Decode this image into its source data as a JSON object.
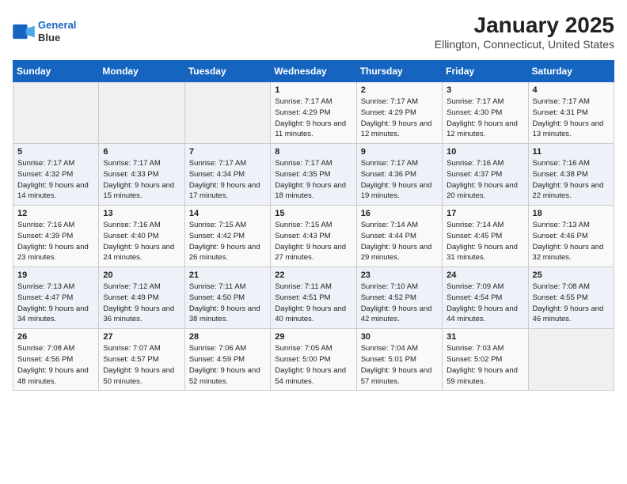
{
  "header": {
    "logo_line1": "General",
    "logo_line2": "Blue",
    "month": "January 2025",
    "location": "Ellington, Connecticut, United States"
  },
  "weekdays": [
    "Sunday",
    "Monday",
    "Tuesday",
    "Wednesday",
    "Thursday",
    "Friday",
    "Saturday"
  ],
  "weeks": [
    [
      {
        "day": "",
        "empty": true
      },
      {
        "day": "",
        "empty": true
      },
      {
        "day": "",
        "empty": true
      },
      {
        "day": "1",
        "sunrise": "7:17 AM",
        "sunset": "4:29 PM",
        "daylight": "9 hours and 11 minutes."
      },
      {
        "day": "2",
        "sunrise": "7:17 AM",
        "sunset": "4:29 PM",
        "daylight": "9 hours and 12 minutes."
      },
      {
        "day": "3",
        "sunrise": "7:17 AM",
        "sunset": "4:30 PM",
        "daylight": "9 hours and 12 minutes."
      },
      {
        "day": "4",
        "sunrise": "7:17 AM",
        "sunset": "4:31 PM",
        "daylight": "9 hours and 13 minutes."
      }
    ],
    [
      {
        "day": "5",
        "sunrise": "7:17 AM",
        "sunset": "4:32 PM",
        "daylight": "9 hours and 14 minutes."
      },
      {
        "day": "6",
        "sunrise": "7:17 AM",
        "sunset": "4:33 PM",
        "daylight": "9 hours and 15 minutes."
      },
      {
        "day": "7",
        "sunrise": "7:17 AM",
        "sunset": "4:34 PM",
        "daylight": "9 hours and 17 minutes."
      },
      {
        "day": "8",
        "sunrise": "7:17 AM",
        "sunset": "4:35 PM",
        "daylight": "9 hours and 18 minutes."
      },
      {
        "day": "9",
        "sunrise": "7:17 AM",
        "sunset": "4:36 PM",
        "daylight": "9 hours and 19 minutes."
      },
      {
        "day": "10",
        "sunrise": "7:16 AM",
        "sunset": "4:37 PM",
        "daylight": "9 hours and 20 minutes."
      },
      {
        "day": "11",
        "sunrise": "7:16 AM",
        "sunset": "4:38 PM",
        "daylight": "9 hours and 22 minutes."
      }
    ],
    [
      {
        "day": "12",
        "sunrise": "7:16 AM",
        "sunset": "4:39 PM",
        "daylight": "9 hours and 23 minutes."
      },
      {
        "day": "13",
        "sunrise": "7:16 AM",
        "sunset": "4:40 PM",
        "daylight": "9 hours and 24 minutes."
      },
      {
        "day": "14",
        "sunrise": "7:15 AM",
        "sunset": "4:42 PM",
        "daylight": "9 hours and 26 minutes."
      },
      {
        "day": "15",
        "sunrise": "7:15 AM",
        "sunset": "4:43 PM",
        "daylight": "9 hours and 27 minutes."
      },
      {
        "day": "16",
        "sunrise": "7:14 AM",
        "sunset": "4:44 PM",
        "daylight": "9 hours and 29 minutes."
      },
      {
        "day": "17",
        "sunrise": "7:14 AM",
        "sunset": "4:45 PM",
        "daylight": "9 hours and 31 minutes."
      },
      {
        "day": "18",
        "sunrise": "7:13 AM",
        "sunset": "4:46 PM",
        "daylight": "9 hours and 32 minutes."
      }
    ],
    [
      {
        "day": "19",
        "sunrise": "7:13 AM",
        "sunset": "4:47 PM",
        "daylight": "9 hours and 34 minutes."
      },
      {
        "day": "20",
        "sunrise": "7:12 AM",
        "sunset": "4:49 PM",
        "daylight": "9 hours and 36 minutes."
      },
      {
        "day": "21",
        "sunrise": "7:11 AM",
        "sunset": "4:50 PM",
        "daylight": "9 hours and 38 minutes."
      },
      {
        "day": "22",
        "sunrise": "7:11 AM",
        "sunset": "4:51 PM",
        "daylight": "9 hours and 40 minutes."
      },
      {
        "day": "23",
        "sunrise": "7:10 AM",
        "sunset": "4:52 PM",
        "daylight": "9 hours and 42 minutes."
      },
      {
        "day": "24",
        "sunrise": "7:09 AM",
        "sunset": "4:54 PM",
        "daylight": "9 hours and 44 minutes."
      },
      {
        "day": "25",
        "sunrise": "7:08 AM",
        "sunset": "4:55 PM",
        "daylight": "9 hours and 46 minutes."
      }
    ],
    [
      {
        "day": "26",
        "sunrise": "7:08 AM",
        "sunset": "4:56 PM",
        "daylight": "9 hours and 48 minutes."
      },
      {
        "day": "27",
        "sunrise": "7:07 AM",
        "sunset": "4:57 PM",
        "daylight": "9 hours and 50 minutes."
      },
      {
        "day": "28",
        "sunrise": "7:06 AM",
        "sunset": "4:59 PM",
        "daylight": "9 hours and 52 minutes."
      },
      {
        "day": "29",
        "sunrise": "7:05 AM",
        "sunset": "5:00 PM",
        "daylight": "9 hours and 54 minutes."
      },
      {
        "day": "30",
        "sunrise": "7:04 AM",
        "sunset": "5:01 PM",
        "daylight": "9 hours and 57 minutes."
      },
      {
        "day": "31",
        "sunrise": "7:03 AM",
        "sunset": "5:02 PM",
        "daylight": "9 hours and 59 minutes."
      },
      {
        "day": "",
        "empty": true
      }
    ]
  ]
}
